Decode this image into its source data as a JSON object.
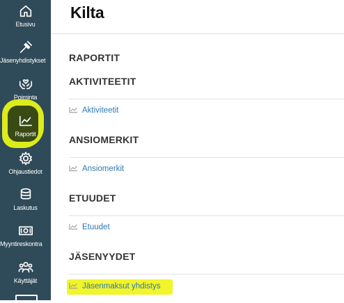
{
  "app": {
    "title": "Kilta"
  },
  "sidebar": {
    "items": [
      {
        "label": "Etusivu",
        "icon": "home-icon"
      },
      {
        "label": "Jäsenyhdistykset",
        "icon": "gavel-icon"
      },
      {
        "label": "Poiminta",
        "icon": "hands-icon"
      },
      {
        "label": "Raportit",
        "icon": "chart-icon"
      },
      {
        "label": "Ohjaustiedot",
        "icon": "gear-icon"
      },
      {
        "label": "Laskutus",
        "icon": "coins-icon"
      },
      {
        "label": "Myyntireskontra",
        "icon": "money-icon"
      },
      {
        "label": "Käyttäjät",
        "icon": "users-icon"
      }
    ]
  },
  "main": {
    "header": "RAPORTIT",
    "sections": [
      {
        "title": "AKTIVITEETIT",
        "link": "Aktiviteetit"
      },
      {
        "title": "ANSIOMERKIT",
        "link": "Ansiomerkit"
      },
      {
        "title": "ETUUDET",
        "link": "Etuudet"
      },
      {
        "title": "JÄSENYYDET",
        "link": "Jäsenmaksut yhdistys"
      }
    ]
  },
  "colors": {
    "sidebar_bg": "#2f4a58",
    "link": "#2f78b5",
    "highlight": "#f1f52a"
  }
}
